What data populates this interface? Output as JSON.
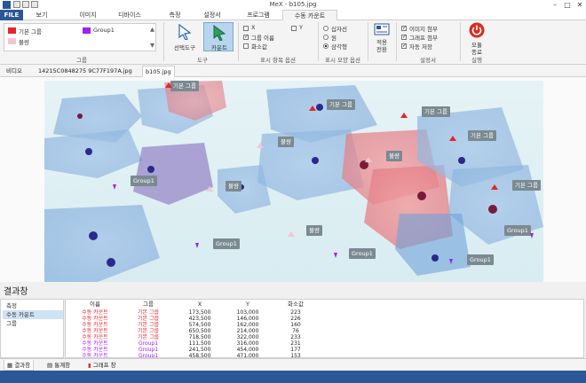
{
  "window": {
    "title": "MeX - b105.jpg"
  },
  "colors": {
    "accent": "#2b5797",
    "red_label": "#e8232a",
    "purple_label": "#a020f0",
    "pink_label": "#f3c6d6",
    "power": "#d62d1f"
  },
  "menu": {
    "file": "FILE",
    "items": [
      "보기",
      "이미지",
      "디바이스",
      "측정",
      "설정서",
      "프로그램",
      "수동 카운트"
    ],
    "active": "수동 카운트"
  },
  "ribbon": {
    "labels_group": {
      "items": [
        {
          "name": "기본 그룹",
          "color": "#e8232a"
        },
        {
          "name": "Group1",
          "color": "#a020f0"
        },
        {
          "name": "불량",
          "color": "#f3c6d6"
        }
      ],
      "caption": "그룹"
    },
    "tools": {
      "select": "선택도구",
      "count": "카운트",
      "caption": "도구"
    },
    "display_items": {
      "x": "X",
      "y": "Y",
      "group_name": "그룹 이름",
      "area": "화소값",
      "caption": "표시 항목 옵션"
    },
    "display_shape": {
      "cross": "십자선",
      "circle": "원",
      "triangle": "삼각형",
      "caption": "표시 모양 옵션"
    },
    "apply": {
      "label": "적용",
      "sub": "전환"
    },
    "report": {
      "image": "이미지 첨부",
      "graph": "그래프 첨부",
      "autosave": "자동 저장",
      "caption": "설정서"
    },
    "exit": {
      "label": "모듈",
      "sub": "종료",
      "caption": "실행"
    }
  },
  "doc_tabs": [
    "비디오",
    "14215C0848275 9C77F197A.jpg",
    "b105.jpg"
  ],
  "image_labels": [
    {
      "text": "기본 그룹",
      "color": "red"
    },
    {
      "text": "기본 그룹",
      "color": "red"
    },
    {
      "text": "기본 그룹",
      "color": "red"
    },
    {
      "text": "기본 그룹",
      "color": "red"
    },
    {
      "text": "기본 그룹",
      "color": "red"
    },
    {
      "text": "불량",
      "color": "pink"
    },
    {
      "text": "불량",
      "color": "pink"
    },
    {
      "text": "불량",
      "color": "pink"
    },
    {
      "text": "불량",
      "color": "pink"
    },
    {
      "text": "Group1",
      "color": "purple"
    },
    {
      "text": "Group1",
      "color": "purple"
    },
    {
      "text": "Group1",
      "color": "purple"
    },
    {
      "text": "Group1",
      "color": "purple"
    },
    {
      "text": "Group1",
      "color": "purple"
    }
  ],
  "results": {
    "title": "결과창",
    "nav": [
      "측정",
      "수동 카운트",
      "그룹"
    ],
    "nav_selected": "수동 카운트",
    "columns": [
      "이름",
      "그룹",
      "X",
      "Y",
      "화소값"
    ],
    "rows": [
      [
        "수동 카운트",
        "기본 그룹",
        "173,500",
        "103,000",
        "223"
      ],
      [
        "수동 카운트",
        "기본 그룹",
        "423,500",
        "146,000",
        "226"
      ],
      [
        "수동 카운트",
        "기본 그룹",
        "574,500",
        "162,000",
        "160"
      ],
      [
        "수동 카운트",
        "기본 그룹",
        "650,500",
        "214,000",
        "76"
      ],
      [
        "수동 카운트",
        "기본 그룹",
        "718,500",
        "322,000",
        "233"
      ],
      [
        "수동 카운트",
        "Group1",
        "111,500",
        "316,000",
        "231"
      ],
      [
        "수동 카운트",
        "Group1",
        "241,500",
        "454,000",
        "177"
      ],
      [
        "수동 카운트",
        "Group1",
        "458,500",
        "471,000",
        "153"
      ]
    ],
    "row_colors": [
      "red",
      "red",
      "red",
      "red",
      "red",
      "purple",
      "purple",
      "purple"
    ]
  },
  "bottom_tabs": [
    "결과창",
    "통계창",
    "그래프 창"
  ]
}
